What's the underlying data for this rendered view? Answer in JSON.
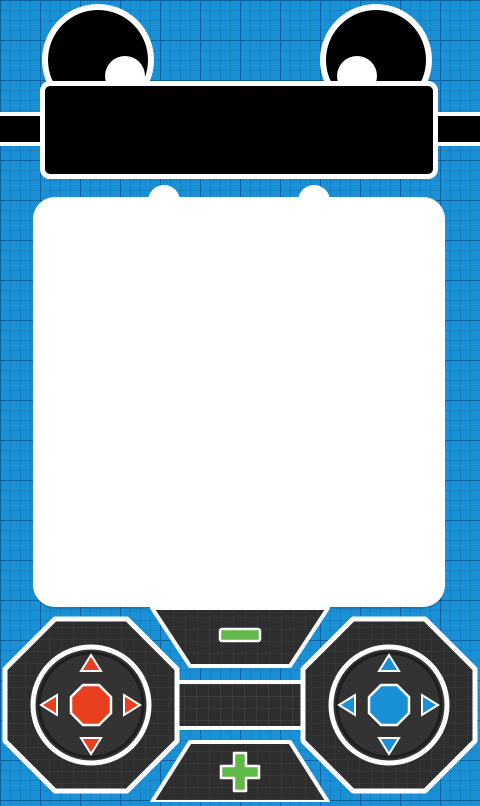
{
  "colors": {
    "background": "#1a91d6",
    "panel": "#2e2e2e",
    "left_accent": "#e8401f",
    "right_accent": "#1a91d6",
    "zoom_accent": "#5fb848"
  },
  "controls": {
    "zoom_out_icon": "minus-icon",
    "zoom_in_icon": "plus-icon",
    "left_pad_icon": "left-dpad",
    "right_pad_icon": "right-dpad"
  }
}
